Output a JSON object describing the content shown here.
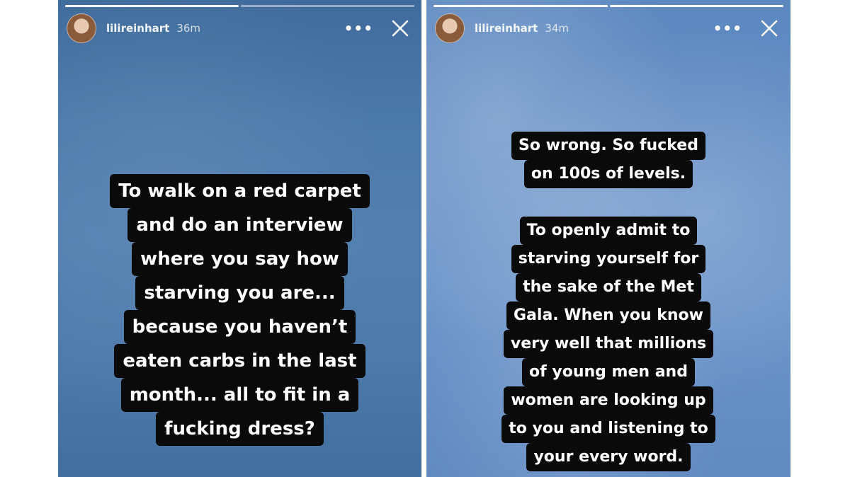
{
  "stories": [
    {
      "username": "lilireinhart",
      "time": "36m",
      "more_icon": "more-dots-icon",
      "close_icon": "close-icon",
      "caption_lines": [
        "To walk on a red carpet",
        "and do an interview",
        "where you say how",
        "starving you are...",
        "because you haven’t",
        "eaten carbs in the last",
        "month... all to fit in a",
        "fucking dress?"
      ]
    },
    {
      "username": "lilireinhart",
      "time": "34m",
      "more_icon": "more-dots-icon",
      "close_icon": "close-icon",
      "caption_lines_1": [
        "So wrong. So fucked",
        "on 100s of levels."
      ],
      "caption_lines_2": [
        "To openly admit to",
        "starving yourself for",
        "the sake of the Met",
        "Gala. When you know",
        "very well that millions",
        "of young men and",
        "women are looking up",
        "to you and listening to",
        "your every word."
      ]
    }
  ],
  "colors": {
    "caption_bg": "#0a0a0a",
    "caption_text": "#ffffff",
    "left_sky": "#4b79aa",
    "right_sky": "#6a93c8"
  }
}
